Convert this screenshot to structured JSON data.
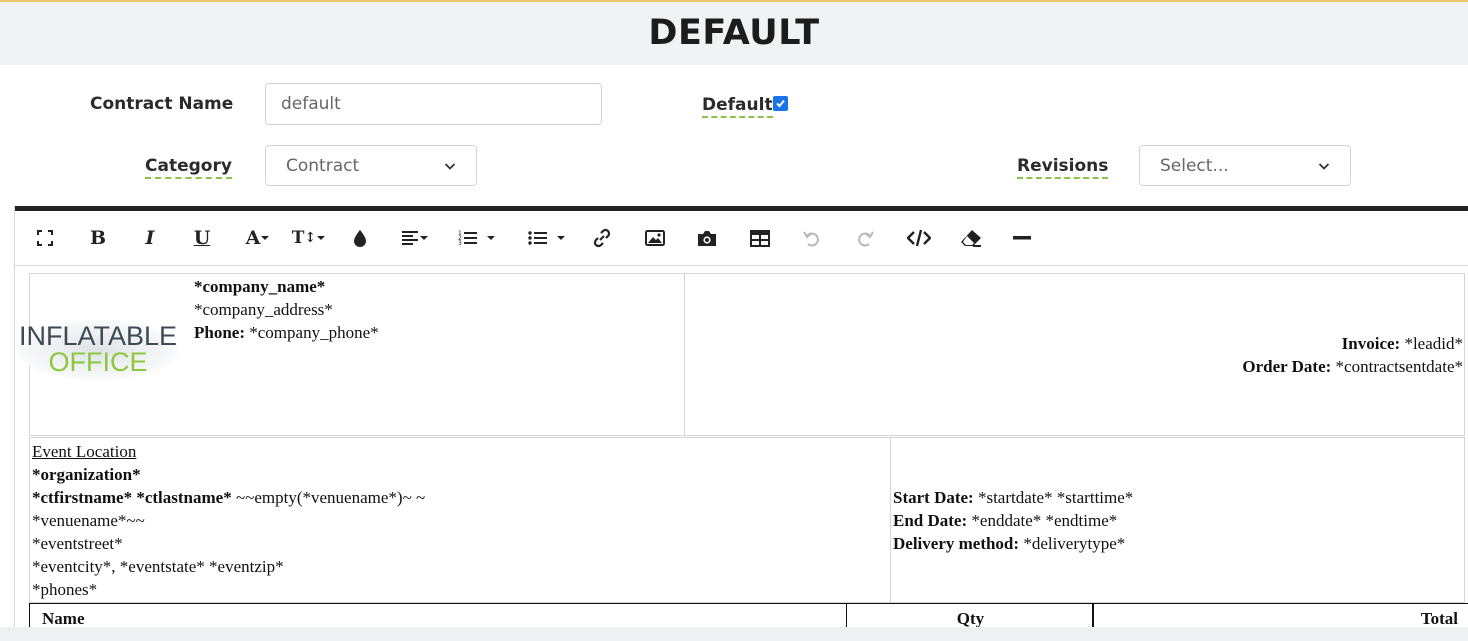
{
  "page": {
    "title": "DEFAULT"
  },
  "form": {
    "contract_name_label": "Contract Name",
    "contract_name_value": "default",
    "default_label": "Default",
    "default_checked": true,
    "category_label": "Category",
    "category_value": "Contract",
    "revisions_label": "Revisions",
    "revisions_value": "Select..."
  },
  "toolbar": {
    "items": [
      "fullscreen-icon",
      "bold-icon",
      "italic-icon",
      "underline-icon",
      "font-color-icon",
      "font-size-icon",
      "color-fill-icon",
      "align-icon",
      "ordered-list-icon",
      "unordered-list-icon",
      "link-icon",
      "image-icon",
      "camera-icon",
      "table-icon",
      "undo-icon",
      "redo-icon",
      "code-view-icon",
      "eraser-icon",
      "horizontal-rule-icon"
    ]
  },
  "logo": {
    "line1": "INFLATABLE",
    "line2": "OFFICE",
    "color1": "#3d4a55",
    "color2": "#8dc63f"
  },
  "document": {
    "company_name": "*company_name*",
    "company_address": "*company_address*",
    "phone_label": "Phone:",
    "phone_value": " *company_phone*",
    "invoice_label": "Invoice:",
    "invoice_value": " *leadid*",
    "order_date_label": "Order Date:",
    "order_date_value": " *contractsentdate*",
    "event_location_title": "Event Location",
    "organization": "*organization*",
    "contact_names": "*ctfirstname* *ctlastname*",
    "venue_condition": " ~~empty(*venuename*)~ ~",
    "venuename": "*venuename*~~",
    "eventstreet": "*eventstreet*",
    "eventcity_line": "*eventcity*, *eventstate* *eventzip*",
    "phones": "*phones*",
    "start_date_label": "Start Date:",
    "start_date_value": " *startdate* *starttime*",
    "end_date_label": "End Date:",
    "end_date_value": " *enddate* *endtime*",
    "delivery_label": "Delivery method:",
    "delivery_value": " *deliverytype*",
    "table_headers": [
      "Name",
      "Qty",
      "Total"
    ]
  }
}
